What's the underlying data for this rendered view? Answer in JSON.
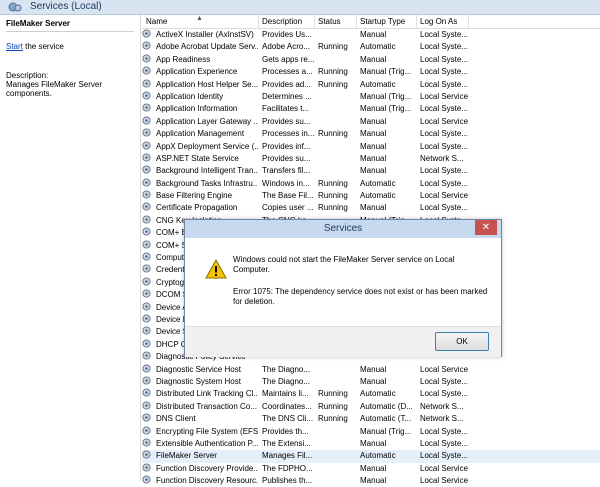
{
  "window": {
    "title": "Services (Local)"
  },
  "left_panel": {
    "service_name": "FileMaker Server",
    "start_link": "Start",
    "start_suffix": " the service",
    "description_label": "Description:",
    "description": "Manages FileMaker Server components."
  },
  "columns": [
    "Name",
    "Description",
    "Status",
    "Startup Type",
    "Log On As"
  ],
  "rows": [
    [
      "ActiveX Installer (AxInstSV)",
      "Provides Us...",
      "",
      "Manual",
      "Local Syste..."
    ],
    [
      "Adobe Acrobat Update Serv...",
      "Adobe Acro...",
      "Running",
      "Automatic",
      "Local Syste..."
    ],
    [
      "App Readiness",
      "Gets apps re...",
      "",
      "Manual",
      "Local Syste..."
    ],
    [
      "Application Experience",
      "Processes a...",
      "Running",
      "Manual (Trig...",
      "Local Syste..."
    ],
    [
      "Application Host Helper Se...",
      "Provides ad...",
      "Running",
      "Automatic",
      "Local Syste..."
    ],
    [
      "Application Identity",
      "Determines ...",
      "",
      "Manual (Trig...",
      "Local Service"
    ],
    [
      "Application Information",
      "Facilitates t...",
      "",
      "Manual (Trig...",
      "Local Syste..."
    ],
    [
      "Application Layer Gateway ...",
      "Provides su...",
      "",
      "Manual",
      "Local Service"
    ],
    [
      "Application Management",
      "Processes in...",
      "Running",
      "Manual",
      "Local Syste..."
    ],
    [
      "AppX Deployment Service (...",
      "Provides inf...",
      "",
      "Manual",
      "Local Syste..."
    ],
    [
      "ASP.NET State Service",
      "Provides su...",
      "",
      "Manual",
      "Network S..."
    ],
    [
      "Background Intelligent Tran...",
      "Transfers fil...",
      "",
      "Manual",
      "Local Syste..."
    ],
    [
      "Background Tasks Infrastru...",
      "Windows in...",
      "Running",
      "Automatic",
      "Local Syste..."
    ],
    [
      "Base Filtering Engine",
      "The Base Fil...",
      "Running",
      "Automatic",
      "Local Service"
    ],
    [
      "Certificate Propagation",
      "Copies user ...",
      "Running",
      "Manual",
      "Local Syste..."
    ],
    [
      "CNG Key Isolation",
      "The CNG ke...",
      "",
      "Manual (Trig...",
      "Local Syste..."
    ],
    [
      "COM+ Event System",
      "",
      "",
      "",
      ""
    ],
    [
      "COM+ System Application",
      "",
      "",
      "",
      ""
    ],
    [
      "Computer Browser",
      "",
      "",
      "",
      ""
    ],
    [
      "Credential Manager",
      "",
      "",
      "",
      ""
    ],
    [
      "Cryptographic Services",
      "",
      "",
      "",
      ""
    ],
    [
      "DCOM Server Process Launcher",
      "",
      "",
      "",
      ""
    ],
    [
      "Device Association Service",
      "",
      "",
      "",
      ""
    ],
    [
      "Device Install Service",
      "",
      "",
      "",
      ""
    ],
    [
      "Device Setup Manager",
      "",
      "",
      "",
      ""
    ],
    [
      "DHCP Client",
      "",
      "",
      "",
      ""
    ],
    [
      "Diagnostic Policy Service",
      "",
      "",
      "",
      ""
    ],
    [
      "Diagnostic Service Host",
      "The Diagno...",
      "",
      "Manual",
      "Local Service"
    ],
    [
      "Diagnostic System Host",
      "The Diagno...",
      "",
      "Manual",
      "Local Syste..."
    ],
    [
      "Distributed Link Tracking Cl...",
      "Maintains li...",
      "Running",
      "Automatic",
      "Local Syste..."
    ],
    [
      "Distributed Transaction Co...",
      "Coordinates...",
      "Running",
      "Automatic (D...",
      "Network S..."
    ],
    [
      "DNS Client",
      "The DNS Cli...",
      "Running",
      "Automatic (T...",
      "Network S..."
    ],
    [
      "Encrypting File System (EFS)",
      "Provides th...",
      "",
      "Manual (Trig...",
      "Local Syste..."
    ],
    [
      "Extensible Authentication P...",
      "The Extensi...",
      "",
      "Manual",
      "Local Syste..."
    ],
    [
      "FileMaker Server",
      "Manages Fil...",
      "",
      "Automatic",
      "Local Syste..."
    ],
    [
      "Function Discovery Provide...",
      "The FDPHO...",
      "",
      "Manual",
      "Local Service"
    ],
    [
      "Function Discovery Resourc...",
      "Publishes th...",
      "",
      "Manual",
      "Local Service"
    ]
  ],
  "selected_row_index": 34,
  "dialog": {
    "title": "Services",
    "close_glyph": "✕",
    "message": "Windows could not start the FileMaker Server service on Local Computer.",
    "error": "Error 1075: The dependency service does not exist or has been marked for deletion.",
    "ok_label": "OK"
  },
  "colors": {
    "dialog_title_bg": "#c7d9ee",
    "close_bg": "#c75050",
    "selected_row": "#e5f0fb",
    "link": "#0645ad"
  },
  "icons": {
    "service_row": "gear-icon",
    "warning": "warning-icon",
    "sort": "sort-ascending-icon"
  }
}
